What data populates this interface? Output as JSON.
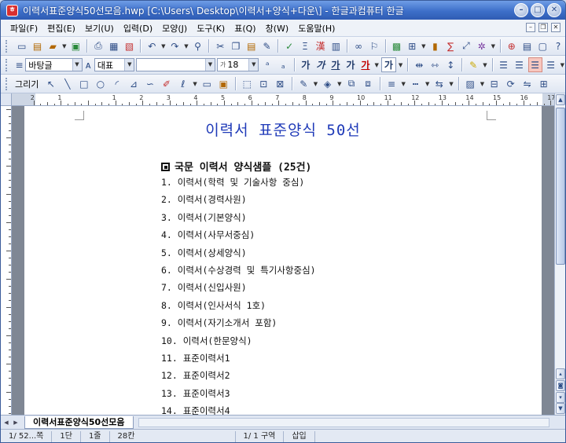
{
  "window": {
    "title": "이력서표준양식50선모음.hwp  [C:\\Users\\        Desktop\\이력서+양식+다운\\] - 한글과컴퓨터 한글",
    "app_icon_glyph": "ㅎ",
    "buttons": {
      "minimize": "–",
      "maximize": "□",
      "close": "✕"
    }
  },
  "menu": {
    "items": [
      "파일(F)",
      "편집(E)",
      "보기(U)",
      "입력(D)",
      "모양(J)",
      "도구(K)",
      "표(Q)",
      "창(W)",
      "도움말(H)"
    ],
    "mdi": {
      "minimize": "–",
      "restore": "❐",
      "close": "✕"
    }
  },
  "format_toolbar": {
    "style": "바탕글",
    "font_lang": "대표",
    "font_name": "",
    "size_prefix": "가",
    "size": "18",
    "buttons": [
      "가",
      "가",
      "가",
      "가",
      "가",
      "가"
    ]
  },
  "draw_toolbar": {
    "label": "그리기"
  },
  "ruler": {
    "numbers": [
      "2",
      "1",
      "1",
      "2",
      "3",
      "4",
      "5",
      "6",
      "7",
      "8",
      "9",
      "10",
      "11",
      "12",
      "13",
      "14",
      "15",
      "16",
      "17",
      "18"
    ]
  },
  "document": {
    "title": "이력서 표준양식 50선",
    "section_heading": "국문 이력서 양식샘플 (25건)",
    "items": [
      "1. 이력서(학력 및 기술사항 중심)",
      "2. 이력서(경력사원)",
      "3. 이력서(기본양식)",
      "4. 이력서(사무서중심)",
      "5. 이력서(상세양식)",
      "6. 이력서(수상경력 및 특기사항중심)",
      "7. 이력서(신입사원)",
      "8. 이력서(인사서식 1호)",
      "9. 이력서(자기소개서 포함)",
      "10. 이력서(한문양식)",
      "11. 표준이력서1",
      "12. 표준이력서2",
      "13. 표준이력서3",
      "14. 표준이력서4"
    ]
  },
  "tab": {
    "label": "이력서표준양식50선모음"
  },
  "status": {
    "page": "1/ 52...쪽",
    "column": "1단",
    "line": "1줄",
    "char": "28칸",
    "section": "1/  1 구역",
    "mode": "삽입"
  }
}
